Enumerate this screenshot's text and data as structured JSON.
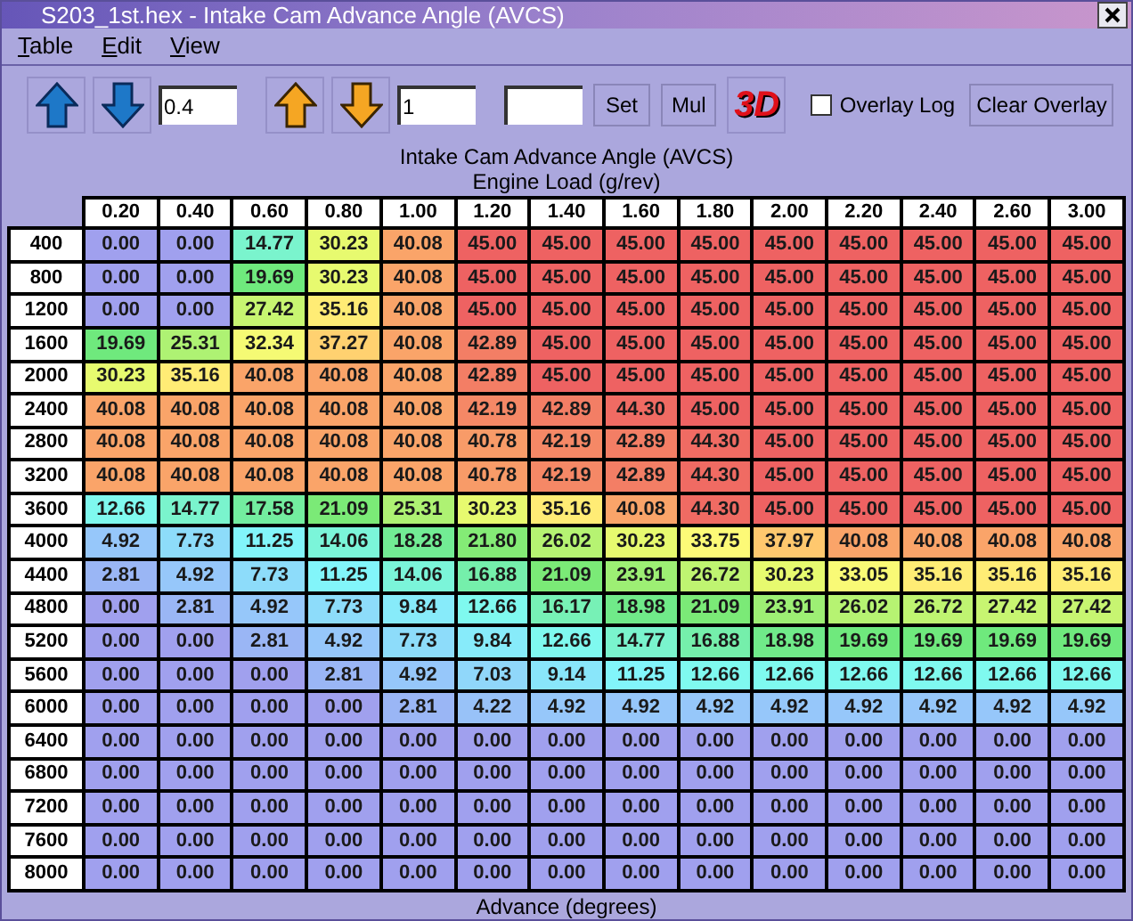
{
  "window": {
    "title": "S203_1st.hex - Intake Cam Advance Angle (AVCS)"
  },
  "menu": [
    "Table",
    "Edit",
    "View"
  ],
  "toolbar": {
    "step_field": {
      "value": "0.4"
    },
    "large_step_field": {
      "value": "1"
    },
    "set_button": "Set",
    "mul_button": "Mul",
    "three_d_button": "3D",
    "overlay_log": {
      "label": "Overlay Log",
      "checked": false
    },
    "clear_overlay_button": "Clear Overlay"
  },
  "table": {
    "title": "Intake Cam Advance Angle (AVCS)",
    "x_axis_label": "Engine Load (g/rev)",
    "footer": "Advance (degrees)",
    "columns": [
      "0.20",
      "0.40",
      "0.60",
      "0.80",
      "1.00",
      "1.20",
      "1.40",
      "1.60",
      "1.80",
      "2.00",
      "2.20",
      "2.40",
      "2.60",
      "3.00"
    ],
    "rows": [
      {
        "label": "400",
        "cells": [
          "0.00",
          "0.00",
          "14.77",
          "30.23",
          "40.08",
          "45.00",
          "45.00",
          "45.00",
          "45.00",
          "45.00",
          "45.00",
          "45.00",
          "45.00",
          "45.00"
        ]
      },
      {
        "label": "800",
        "cells": [
          "0.00",
          "0.00",
          "19.69",
          "30.23",
          "40.08",
          "45.00",
          "45.00",
          "45.00",
          "45.00",
          "45.00",
          "45.00",
          "45.00",
          "45.00",
          "45.00"
        ]
      },
      {
        "label": "1200",
        "cells": [
          "0.00",
          "0.00",
          "27.42",
          "35.16",
          "40.08",
          "45.00",
          "45.00",
          "45.00",
          "45.00",
          "45.00",
          "45.00",
          "45.00",
          "45.00",
          "45.00"
        ]
      },
      {
        "label": "1600",
        "cells": [
          "19.69",
          "25.31",
          "32.34",
          "37.27",
          "40.08",
          "42.89",
          "45.00",
          "45.00",
          "45.00",
          "45.00",
          "45.00",
          "45.00",
          "45.00",
          "45.00"
        ]
      },
      {
        "label": "2000",
        "cells": [
          "30.23",
          "35.16",
          "40.08",
          "40.08",
          "40.08",
          "42.89",
          "45.00",
          "45.00",
          "45.00",
          "45.00",
          "45.00",
          "45.00",
          "45.00",
          "45.00"
        ]
      },
      {
        "label": "2400",
        "cells": [
          "40.08",
          "40.08",
          "40.08",
          "40.08",
          "40.08",
          "42.19",
          "42.89",
          "44.30",
          "45.00",
          "45.00",
          "45.00",
          "45.00",
          "45.00",
          "45.00"
        ]
      },
      {
        "label": "2800",
        "cells": [
          "40.08",
          "40.08",
          "40.08",
          "40.08",
          "40.08",
          "40.78",
          "42.19",
          "42.89",
          "44.30",
          "45.00",
          "45.00",
          "45.00",
          "45.00",
          "45.00"
        ]
      },
      {
        "label": "3200",
        "cells": [
          "40.08",
          "40.08",
          "40.08",
          "40.08",
          "40.08",
          "40.78",
          "42.19",
          "42.89",
          "44.30",
          "45.00",
          "45.00",
          "45.00",
          "45.00",
          "45.00"
        ]
      },
      {
        "label": "3600",
        "cells": [
          "12.66",
          "14.77",
          "17.58",
          "21.09",
          "25.31",
          "30.23",
          "35.16",
          "40.08",
          "44.30",
          "45.00",
          "45.00",
          "45.00",
          "45.00",
          "45.00"
        ]
      },
      {
        "label": "4000",
        "cells": [
          "4.92",
          "7.73",
          "11.25",
          "14.06",
          "18.28",
          "21.80",
          "26.02",
          "30.23",
          "33.75",
          "37.97",
          "40.08",
          "40.08",
          "40.08",
          "40.08"
        ]
      },
      {
        "label": "4400",
        "cells": [
          "2.81",
          "4.92",
          "7.73",
          "11.25",
          "14.06",
          "16.88",
          "21.09",
          "23.91",
          "26.72",
          "30.23",
          "33.05",
          "35.16",
          "35.16",
          "35.16"
        ]
      },
      {
        "label": "4800",
        "cells": [
          "0.00",
          "2.81",
          "4.92",
          "7.73",
          "9.84",
          "12.66",
          "16.17",
          "18.98",
          "21.09",
          "23.91",
          "26.02",
          "26.72",
          "27.42",
          "27.42"
        ]
      },
      {
        "label": "5200",
        "cells": [
          "0.00",
          "0.00",
          "2.81",
          "4.92",
          "7.73",
          "9.84",
          "12.66",
          "14.77",
          "16.88",
          "18.98",
          "19.69",
          "19.69",
          "19.69",
          "19.69"
        ]
      },
      {
        "label": "5600",
        "cells": [
          "0.00",
          "0.00",
          "0.00",
          "2.81",
          "4.92",
          "7.03",
          "9.14",
          "11.25",
          "12.66",
          "12.66",
          "12.66",
          "12.66",
          "12.66",
          "12.66"
        ]
      },
      {
        "label": "6000",
        "cells": [
          "0.00",
          "0.00",
          "0.00",
          "0.00",
          "2.81",
          "4.22",
          "4.92",
          "4.92",
          "4.92",
          "4.92",
          "4.92",
          "4.92",
          "4.92",
          "4.92"
        ]
      },
      {
        "label": "6400",
        "cells": [
          "0.00",
          "0.00",
          "0.00",
          "0.00",
          "0.00",
          "0.00",
          "0.00",
          "0.00",
          "0.00",
          "0.00",
          "0.00",
          "0.00",
          "0.00",
          "0.00"
        ]
      },
      {
        "label": "6800",
        "cells": [
          "0.00",
          "0.00",
          "0.00",
          "0.00",
          "0.00",
          "0.00",
          "0.00",
          "0.00",
          "0.00",
          "0.00",
          "0.00",
          "0.00",
          "0.00",
          "0.00"
        ]
      },
      {
        "label": "7200",
        "cells": [
          "0.00",
          "0.00",
          "0.00",
          "0.00",
          "0.00",
          "0.00",
          "0.00",
          "0.00",
          "0.00",
          "0.00",
          "0.00",
          "0.00",
          "0.00",
          "0.00"
        ]
      },
      {
        "label": "7600",
        "cells": [
          "0.00",
          "0.00",
          "0.00",
          "0.00",
          "0.00",
          "0.00",
          "0.00",
          "0.00",
          "0.00",
          "0.00",
          "0.00",
          "0.00",
          "0.00",
          "0.00"
        ]
      },
      {
        "label": "8000",
        "cells": [
          "0.00",
          "0.00",
          "0.00",
          "0.00",
          "0.00",
          "0.00",
          "0.00",
          "0.00",
          "0.00",
          "0.00",
          "0.00",
          "0.00",
          "0.00",
          "0.00"
        ]
      }
    ]
  }
}
